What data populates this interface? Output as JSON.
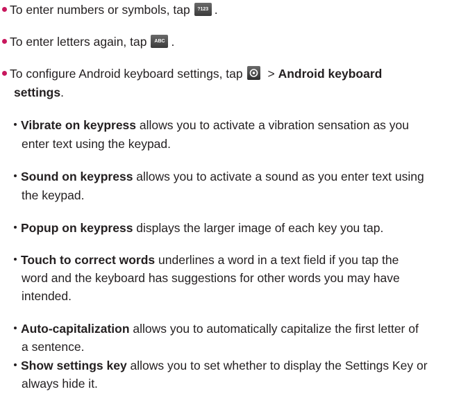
{
  "bullets": [
    {
      "text_before": "To enter numbers or symbols, tap",
      "key_label": "?123",
      "text_after": "."
    },
    {
      "text_before": "To enter letters again, tap",
      "key_label": "ABC",
      "text_after": "."
    },
    {
      "text_before": "To configure Android keyboard settings, tap",
      "key_icon": "gear-icon",
      "text_mid": " > ",
      "bold_line1": "Android keyboard",
      "bold_line2": "settings",
      "text_after": "."
    }
  ],
  "settings": [
    {
      "term": "Vibrate on keypress",
      "line1": " allows you to activate a vibration sensation as you",
      "line2": "enter text using the keypad."
    },
    {
      "term": "Sound on keypress",
      "line1": " allows you to activate a sound as you enter text using",
      "line2": "the keypad."
    },
    {
      "term": "Popup on keypress",
      "line1": " displays the larger image of each key you tap."
    },
    {
      "term": "Touch to correct words",
      "line1": " underlines a word in a text field if you tap the",
      "line2": "word and the keyboard has suggestions for other words you may have",
      "line3": "intended."
    },
    {
      "term": "Auto-capitalization",
      "line1": " allows you to automatically capitalize the first letter of",
      "line2": "a sentence."
    },
    {
      "term": "Show settings key",
      "line1": " allows you to set whether to display the Settings Key or",
      "line2": "always hide it."
    }
  ],
  "colors": {
    "bullet": "#c8175d",
    "text": "#231f20"
  }
}
